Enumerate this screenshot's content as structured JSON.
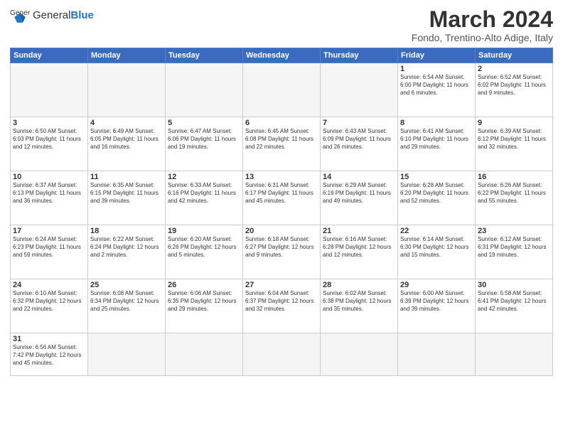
{
  "header": {
    "logo_general": "General",
    "logo_blue": "Blue",
    "month_title": "March 2024",
    "location": "Fondo, Trentino-Alto Adige, Italy"
  },
  "weekdays": [
    "Sunday",
    "Monday",
    "Tuesday",
    "Wednesday",
    "Thursday",
    "Friday",
    "Saturday"
  ],
  "weeks": [
    [
      {
        "day": "",
        "info": ""
      },
      {
        "day": "",
        "info": ""
      },
      {
        "day": "",
        "info": ""
      },
      {
        "day": "",
        "info": ""
      },
      {
        "day": "",
        "info": ""
      },
      {
        "day": "1",
        "info": "Sunrise: 6:54 AM\nSunset: 6:00 PM\nDaylight: 11 hours and 6 minutes."
      },
      {
        "day": "2",
        "info": "Sunrise: 6:52 AM\nSunset: 6:02 PM\nDaylight: 11 hours and 9 minutes."
      }
    ],
    [
      {
        "day": "3",
        "info": "Sunrise: 6:50 AM\nSunset: 6:03 PM\nDaylight: 11 hours and 12 minutes."
      },
      {
        "day": "4",
        "info": "Sunrise: 6:49 AM\nSunset: 6:05 PM\nDaylight: 11 hours and 16 minutes."
      },
      {
        "day": "5",
        "info": "Sunrise: 6:47 AM\nSunset: 6:06 PM\nDaylight: 11 hours and 19 minutes."
      },
      {
        "day": "6",
        "info": "Sunrise: 6:45 AM\nSunset: 6:08 PM\nDaylight: 11 hours and 22 minutes."
      },
      {
        "day": "7",
        "info": "Sunrise: 6:43 AM\nSunset: 6:09 PM\nDaylight: 11 hours and 26 minutes."
      },
      {
        "day": "8",
        "info": "Sunrise: 6:41 AM\nSunset: 6:10 PM\nDaylight: 11 hours and 29 minutes."
      },
      {
        "day": "9",
        "info": "Sunrise: 6:39 AM\nSunset: 6:12 PM\nDaylight: 11 hours and 32 minutes."
      }
    ],
    [
      {
        "day": "10",
        "info": "Sunrise: 6:37 AM\nSunset: 6:13 PM\nDaylight: 11 hours and 36 minutes."
      },
      {
        "day": "11",
        "info": "Sunrise: 6:35 AM\nSunset: 6:15 PM\nDaylight: 11 hours and 39 minutes."
      },
      {
        "day": "12",
        "info": "Sunrise: 6:33 AM\nSunset: 6:16 PM\nDaylight: 11 hours and 42 minutes."
      },
      {
        "day": "13",
        "info": "Sunrise: 6:31 AM\nSunset: 6:17 PM\nDaylight: 11 hours and 45 minutes."
      },
      {
        "day": "14",
        "info": "Sunrise: 6:29 AM\nSunset: 6:19 PM\nDaylight: 11 hours and 49 minutes."
      },
      {
        "day": "15",
        "info": "Sunrise: 6:28 AM\nSunset: 6:20 PM\nDaylight: 11 hours and 52 minutes."
      },
      {
        "day": "16",
        "info": "Sunrise: 6:26 AM\nSunset: 6:22 PM\nDaylight: 11 hours and 55 minutes."
      }
    ],
    [
      {
        "day": "17",
        "info": "Sunrise: 6:24 AM\nSunset: 6:23 PM\nDaylight: 11 hours and 59 minutes."
      },
      {
        "day": "18",
        "info": "Sunrise: 6:22 AM\nSunset: 6:24 PM\nDaylight: 12 hours and 2 minutes."
      },
      {
        "day": "19",
        "info": "Sunrise: 6:20 AM\nSunset: 6:26 PM\nDaylight: 12 hours and 5 minutes."
      },
      {
        "day": "20",
        "info": "Sunrise: 6:18 AM\nSunset: 6:27 PM\nDaylight: 12 hours and 9 minutes."
      },
      {
        "day": "21",
        "info": "Sunrise: 6:16 AM\nSunset: 6:28 PM\nDaylight: 12 hours and 12 minutes."
      },
      {
        "day": "22",
        "info": "Sunrise: 6:14 AM\nSunset: 6:30 PM\nDaylight: 12 hours and 15 minutes."
      },
      {
        "day": "23",
        "info": "Sunrise: 6:12 AM\nSunset: 6:31 PM\nDaylight: 12 hours and 19 minutes."
      }
    ],
    [
      {
        "day": "24",
        "info": "Sunrise: 6:10 AM\nSunset: 6:32 PM\nDaylight: 12 hours and 22 minutes."
      },
      {
        "day": "25",
        "info": "Sunrise: 6:08 AM\nSunset: 6:34 PM\nDaylight: 12 hours and 25 minutes."
      },
      {
        "day": "26",
        "info": "Sunrise: 6:06 AM\nSunset: 6:35 PM\nDaylight: 12 hours and 29 minutes."
      },
      {
        "day": "27",
        "info": "Sunrise: 6:04 AM\nSunset: 6:37 PM\nDaylight: 12 hours and 32 minutes."
      },
      {
        "day": "28",
        "info": "Sunrise: 6:02 AM\nSunset: 6:38 PM\nDaylight: 12 hours and 35 minutes."
      },
      {
        "day": "29",
        "info": "Sunrise: 6:00 AM\nSunset: 6:39 PM\nDaylight: 12 hours and 39 minutes."
      },
      {
        "day": "30",
        "info": "Sunrise: 5:58 AM\nSunset: 6:41 PM\nDaylight: 12 hours and 42 minutes."
      }
    ],
    [
      {
        "day": "31",
        "info": "Sunrise: 6:56 AM\nSunset: 7:42 PM\nDaylight: 12 hours and 45 minutes."
      },
      {
        "day": "",
        "info": ""
      },
      {
        "day": "",
        "info": ""
      },
      {
        "day": "",
        "info": ""
      },
      {
        "day": "",
        "info": ""
      },
      {
        "day": "",
        "info": ""
      },
      {
        "day": "",
        "info": ""
      }
    ]
  ]
}
